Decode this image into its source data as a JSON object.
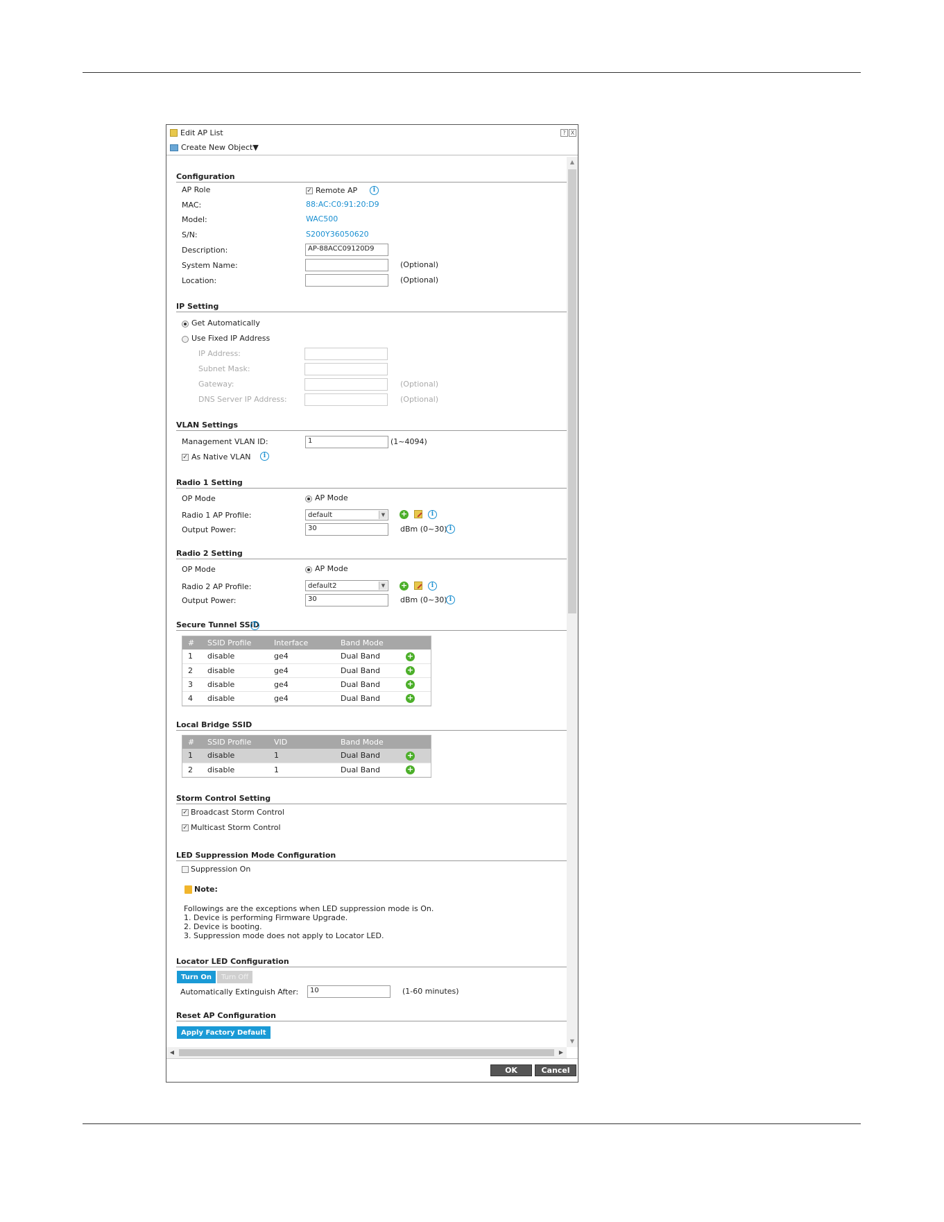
{
  "dialog": {
    "title": "Edit AP List",
    "title_buttons": [
      "?",
      "X"
    ],
    "toolbar": {
      "create_label": "Create New Object▼"
    },
    "footer": {
      "ok_label": "OK",
      "cancel_label": "Cancel"
    }
  },
  "configuration": {
    "section": "Configuration",
    "ap_role_label": "AP Role",
    "remote_ap_label": "Remote AP",
    "remote_ap_checked": true,
    "mac_label": "MAC:",
    "mac_value": "88:AC:C0:91:20:D9",
    "model_label": "Model:",
    "model_value": "WAC500",
    "sn_label": "S/N:",
    "sn_value": "S200Y36050620",
    "description_label": "Description:",
    "description_value": "AP-88ACC09120D9",
    "system_name_label": "System Name:",
    "system_name_value": "",
    "location_label": "Location:",
    "location_value": "",
    "optional_text": "(Optional)"
  },
  "ip_setting": {
    "section": "IP Setting",
    "get_auto_label": "Get Automatically",
    "fixed_label": "Use Fixed IP Address",
    "ip_label": "IP Address:",
    "subnet_label": "Subnet Mask:",
    "gateway_label": "Gateway:",
    "dns_label": "DNS Server IP Address:",
    "optional_text": "(Optional)"
  },
  "vlan": {
    "section": "VLAN Settings",
    "mgmt_label": "Management VLAN ID:",
    "mgmt_value": "1",
    "range_text": "(1~4094)",
    "native_label": "As Native VLAN",
    "native_checked": true
  },
  "radio1": {
    "section": "Radio 1 Setting",
    "op_mode_label": "OP Mode",
    "op_mode_value": "AP Mode",
    "profile_label": "Radio 1 AP Profile:",
    "profile_value": "default",
    "power_label": "Output Power:",
    "power_value": "30",
    "power_unit": "dBm (0~30)"
  },
  "radio2": {
    "section": "Radio 2 Setting",
    "op_mode_label": "OP Mode",
    "op_mode_value": "AP Mode",
    "profile_label": "Radio 2 AP Profile:",
    "profile_value": "default2",
    "power_label": "Output Power:",
    "power_value": "30",
    "power_unit": "dBm (0~30)"
  },
  "secure_tunnel": {
    "section": "Secure Tunnel SSID",
    "columns": [
      "#",
      "SSID Profile",
      "Interface",
      "Band Mode"
    ],
    "rows": [
      [
        "1",
        "disable",
        "ge4",
        "Dual Band"
      ],
      [
        "2",
        "disable",
        "ge4",
        "Dual Band"
      ],
      [
        "3",
        "disable",
        "ge4",
        "Dual Band"
      ],
      [
        "4",
        "disable",
        "ge4",
        "Dual Band"
      ]
    ]
  },
  "local_bridge": {
    "section": "Local Bridge SSID",
    "columns": [
      "#",
      "SSID Profile",
      "VID",
      "Band Mode"
    ],
    "rows": [
      [
        "1",
        "disable",
        "1",
        "Dual Band"
      ],
      [
        "2",
        "disable",
        "1",
        "Dual Band"
      ]
    ]
  },
  "storm": {
    "section": "Storm Control Setting",
    "broadcast_label": "Broadcast Storm Control",
    "multicast_label": "Multicast Storm Control"
  },
  "led_suppression": {
    "section": "LED Suppression Mode Configuration",
    "suppression_label": "Suppression On",
    "note_title": "Note:",
    "note_lines": [
      "Followings are the exceptions when LED suppression mode is On.",
      "1. Device is performing Firmware Upgrade.",
      "2. Device is booting.",
      "3. Suppression mode does not apply to Locator LED."
    ]
  },
  "locator": {
    "section": "Locator LED Configuration",
    "turn_on_label": "Turn On",
    "turn_off_label": "Turn Off",
    "extinguish_label": "Automatically Extinguish After:",
    "extinguish_value": "10",
    "extinguish_range": "(1-60 minutes)"
  },
  "reset": {
    "section": "Reset AP Configuration",
    "factory_label": "Apply Factory Default"
  },
  "colors": {
    "link_blue": "#1a8fd1",
    "button_blue": "#1a9ad6",
    "add_green": "#4caf2a",
    "table_header": "#a7a7a7"
  }
}
